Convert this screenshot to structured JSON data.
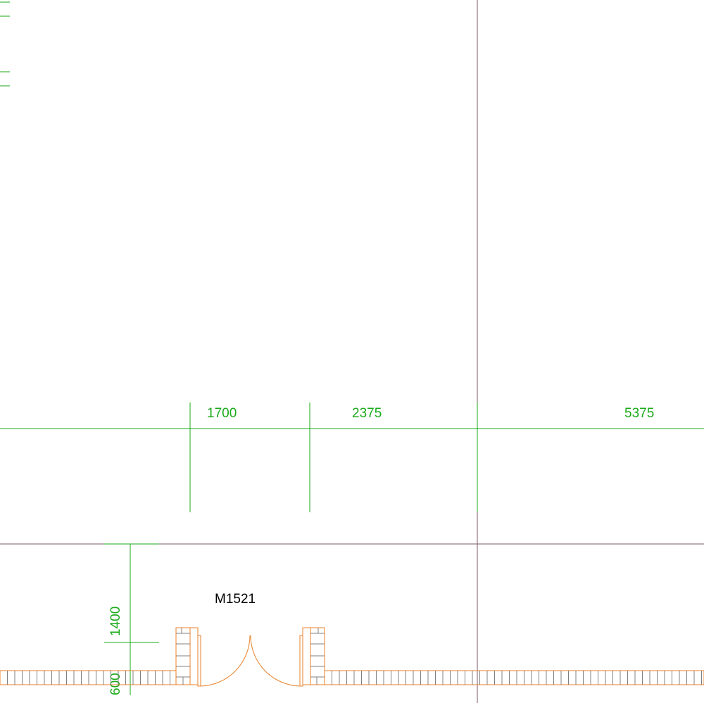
{
  "drawing": {
    "colors": {
      "background": "#ffffff",
      "dimension": "#1aaa1a",
      "axis": "#7a5a6a",
      "wall": "#e8822a",
      "hatch": "#808080",
      "label": "#000000"
    },
    "dimensions": {
      "horizontal": [
        "1700",
        "2375",
        "5375"
      ],
      "vertical": [
        "1400",
        "600"
      ]
    },
    "door_tag": "M1521"
  }
}
